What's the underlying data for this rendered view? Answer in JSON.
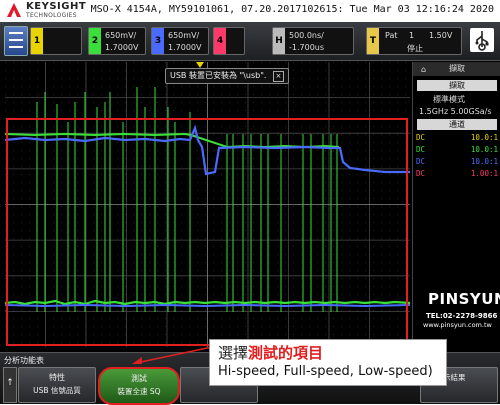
{
  "header": {
    "brand": "KEYSIGHT",
    "brand_sub": "TECHNOLOGIES",
    "instrument_info": "MSO-X 4154A, MY59101061, 07.20.2017102615: Tue Mar 03 12:16:24 2020"
  },
  "toolbar": {
    "ch1_number": "1",
    "ch2_number": "2",
    "ch2_scale": "650mV/",
    "ch2_offset": "1.7000V",
    "ch3_number": "3",
    "ch3_scale": "650mV/",
    "ch3_offset": "1.7000V",
    "ch4_number": "4",
    "horiz_tag": "H",
    "horiz_scale": "500.0ns/",
    "horiz_delay": "-1.700us",
    "trig_tag": "T",
    "trig_mode": "Pat",
    "trig_channel": "1",
    "trig_level": "1.50V",
    "run_state": "停止"
  },
  "grid": {
    "notice": "USB 裝置已安裝為 \"\\usb\"."
  },
  "side_panel": {
    "title": "擷取",
    "acquire_header": "擷取",
    "acquire_mode": "標準模式",
    "sample_rate": "1.5GHz   5.00GSa/s",
    "channels_header": "通道",
    "channels": [
      {
        "coupling": "DC",
        "probe": "10.0:1",
        "color": "#e8d400"
      },
      {
        "coupling": "DC",
        "probe": "10.0:1",
        "color": "#3adf3a"
      },
      {
        "coupling": "DC",
        "probe": "10.0:1",
        "color": "#4a6bff"
      },
      {
        "coupling": "DC",
        "probe": "1.00:1",
        "color": "#ff3a6a"
      }
    ]
  },
  "softbar": {
    "title": "分析功能表",
    "keys": [
      {
        "line1": "特性",
        "line2": "USB 信號品質"
      },
      {
        "line1": "測試",
        "line2": "裝置全速 SQ"
      },
      {
        "line1": "",
        "line2": ""
      },
      {
        "line1": "",
        "line2": "示結果"
      }
    ]
  },
  "callout": {
    "line1_pre": "選擇",
    "line1_highlight": "測試的項目",
    "line2": "Hi-speed, Full-speed, Low-speed)"
  },
  "watermark": {
    "brand": "PINSYUN",
    "tel": "TEL:02-2278-9866",
    "url": "www.pinsyun.com.tw"
  },
  "colors": {
    "ch1": "#e8d400",
    "ch2": "#3adf3a",
    "ch3": "#4a6bff",
    "ch4": "#ff3a6a",
    "highlight_box": "#e02020"
  }
}
